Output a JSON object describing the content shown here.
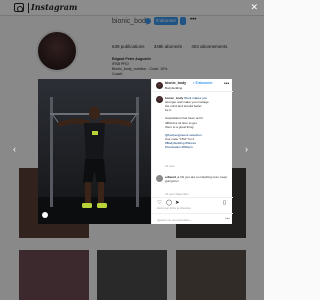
{
  "app": {
    "brand": "Instagram"
  },
  "profile": {
    "username": "bionic_body",
    "follow_label": "S'abonner",
    "stats": [
      "639 publications",
      "348k abonnés",
      "404 abonnements"
    ],
    "bio": [
      "Edgard Peter Augustin",
      "IFBB PRO",
      "Bionic_body_nutrition - Code: 15%",
      "Coach"
    ]
  },
  "post": {
    "header": {
      "username": "bionic_body",
      "follow_label": "• S'abonner",
      "location": "Bodybuilding"
    },
    "caption": {
      "username": "bionic_body",
      "lines": [
        "Work makes you",
        "stronger and make you manage",
        "the mind and should better",
        "be it.",
        "",
        "Acquisitions has been at hit",
        "difficult a lot time to get",
        "them to a great thing.",
        "",
        "@bodyengineers selection.",
        "Use code \"15%\" for it.",
        "#Bodybuilding #fitness",
        "#motivation #ifbbpro"
      ],
      "time": "22 sem"
    },
    "comment": {
      "username": "edward_e",
      "text": "Ok you are so inspiring man, keep going bro!",
      "meta": "22 sem   Répondre"
    },
    "likes": "Aimé par kriss et d'autres",
    "comment_placeholder": "Ajouter un commentaire..."
  },
  "icons": {
    "close": "close-icon",
    "prev": "chevron-left-icon",
    "next": "chevron-right-icon",
    "like": "heart-icon",
    "comment": "comment-icon",
    "share": "send-icon",
    "save": "bookmark-icon"
  },
  "colors": {
    "accent": "#3897f0",
    "overlay": "rgba(0,0,0,0.45)"
  }
}
